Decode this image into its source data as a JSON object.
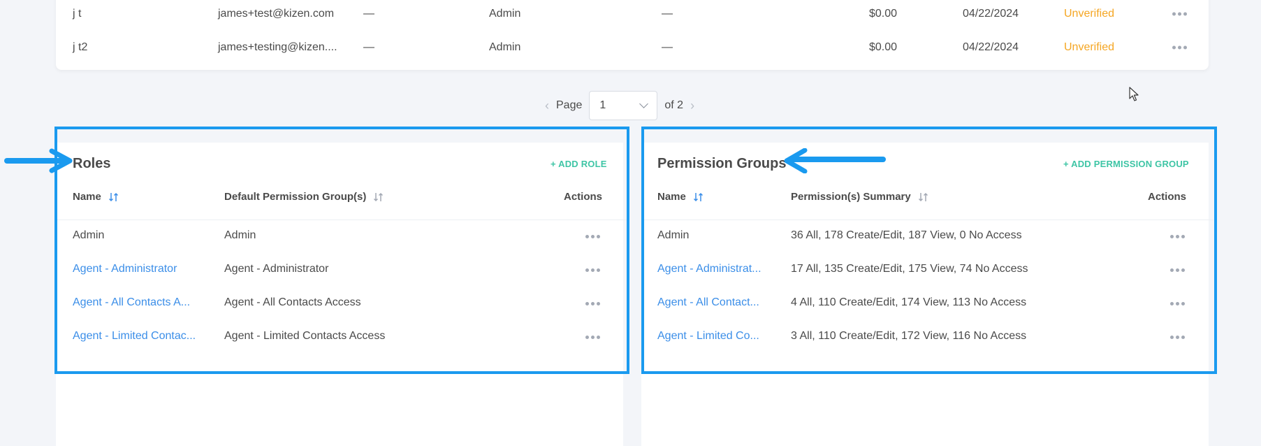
{
  "users_table": {
    "rows": [
      {
        "name": "j t",
        "email": "james+test@kizen.com",
        "dash1": "—",
        "role": "Admin",
        "dash2": "—",
        "amount": "$0.00",
        "date": "04/22/2024",
        "status": "Unverified"
      },
      {
        "name": "j t2",
        "email": "james+testing@kizen....",
        "dash1": "—",
        "role": "Admin",
        "dash2": "—",
        "amount": "$0.00",
        "date": "04/22/2024",
        "status": "Unverified"
      }
    ]
  },
  "pagination": {
    "page_label": "Page",
    "current_page": "1",
    "of_label": "of 2"
  },
  "roles": {
    "title": "Roles",
    "add_label": "+ ADD ROLE",
    "columns": [
      "Name",
      "Default Permission Group(s)",
      "Actions"
    ],
    "rows": [
      {
        "name": "Admin",
        "group": "Admin"
      },
      {
        "name": "Agent - Administrator",
        "group": "Agent - Administrator"
      },
      {
        "name": "Agent - All Contacts A...",
        "group": "Agent - All Contacts Access"
      },
      {
        "name": "Agent - Limited Contac...",
        "group": "Agent - Limited Contacts Access"
      }
    ]
  },
  "permission_groups": {
    "title": "Permission Groups",
    "add_label": "+ ADD PERMISSION GROUP",
    "columns": [
      "Name",
      "Permission(s) Summary",
      "Actions"
    ],
    "rows": [
      {
        "name": "Admin",
        "summary": "36 All, 178 Create/Edit, 187 View, 0 No Access"
      },
      {
        "name": "Agent - Administrat...",
        "summary": "17 All, 135 Create/Edit, 175 View, 74 No Access"
      },
      {
        "name": "Agent - All Contact...",
        "summary": "4 All, 110 Create/Edit, 174 View, 113 No Access"
      },
      {
        "name": "Agent - Limited Co...",
        "summary": "3 All, 110 Create/Edit, 172 View, 116 No Access"
      }
    ]
  },
  "colors": {
    "highlight": "#1a9aef",
    "link": "#3b8ee8",
    "add_link": "#3ec5a5",
    "unverified": "#f5a623"
  },
  "icons": [
    "sort-icon",
    "more-actions-icon",
    "chevron-left-icon",
    "chevron-right-icon",
    "chevron-down-icon",
    "arrow-annotation-icon",
    "mouse-cursor-icon"
  ]
}
